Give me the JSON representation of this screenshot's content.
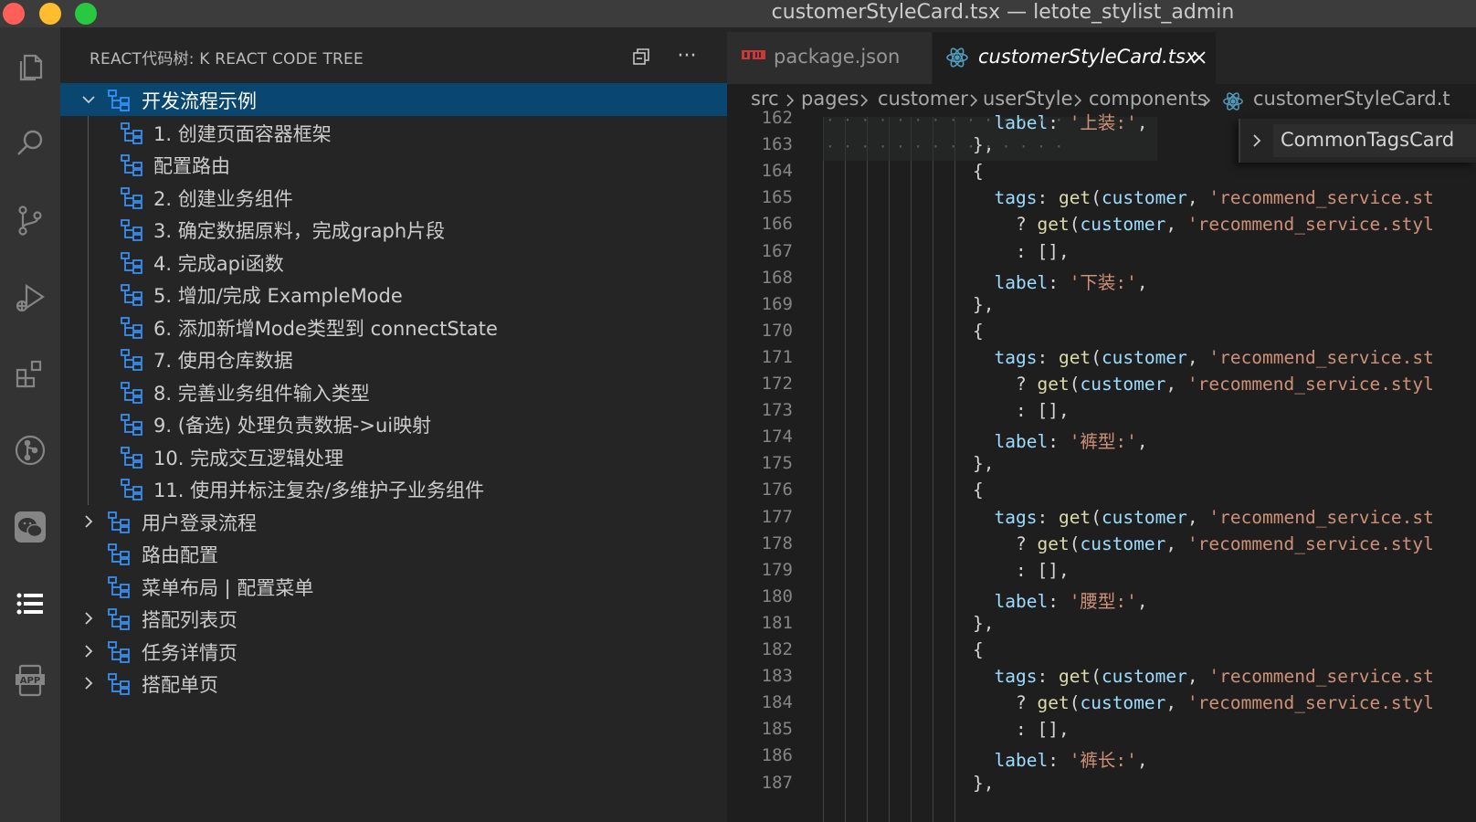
{
  "window": {
    "title": "customerStyleCard.tsx — letote_stylist_admin"
  },
  "activity_bar": {
    "items": [
      {
        "icon": "files-icon"
      },
      {
        "icon": "search-icon"
      },
      {
        "icon": "source-control-icon"
      },
      {
        "icon": "run-debug-icon"
      },
      {
        "icon": "extensions-icon"
      },
      {
        "icon": "git-graph-icon"
      },
      {
        "icon": "wechat-icon"
      },
      {
        "icon": "list-icon",
        "active": true
      },
      {
        "icon": "app-icon"
      }
    ]
  },
  "sidebar": {
    "title": "REACT代码树: K REACT CODE TREE",
    "actions": [
      {
        "icon": "collapse-all-icon"
      },
      {
        "icon": "more-actions-icon",
        "label": "···"
      }
    ],
    "tree": [
      {
        "label": "开发流程示例",
        "level": 0,
        "expanded": true,
        "selected": true
      },
      {
        "label": "1. 创建页面容器框架",
        "level": 1
      },
      {
        "label": "配置路由",
        "level": 1
      },
      {
        "label": "2. 创建业务组件",
        "level": 1
      },
      {
        "label": "3. 确定数据原料，完成graph片段",
        "level": 1
      },
      {
        "label": "4. 完成api函数",
        "level": 1
      },
      {
        "label": "5. 增加/完成 ExampleMode",
        "level": 1
      },
      {
        "label": "6. 添加新增Mode类型到 connectState",
        "level": 1
      },
      {
        "label": "7. 使用仓库数据",
        "level": 1
      },
      {
        "label": "8. 完善业务组件输入类型",
        "level": 1
      },
      {
        "label": "9. (备选) 处理负责数据->ui映射",
        "level": 1
      },
      {
        "label": "10. 完成交互逻辑处理",
        "level": 1
      },
      {
        "label": "11. 使用并标注复杂/多维护子业务组件",
        "level": 1
      },
      {
        "label": "用户登录流程",
        "level": 0,
        "expanded": false
      },
      {
        "label": "路由配置",
        "level": 0
      },
      {
        "label": "菜单布局 | 配置菜单",
        "level": 0
      },
      {
        "label": "搭配列表页",
        "level": 0,
        "expanded": false
      },
      {
        "label": "任务详情页",
        "level": 0,
        "expanded": false
      },
      {
        "label": "搭配单页",
        "level": 0,
        "expanded": false
      }
    ]
  },
  "editor": {
    "tabs": [
      {
        "label": "package.json",
        "icon": "npm-icon",
        "active": false
      },
      {
        "label": "customerStyleCard.tsx",
        "icon": "react-icon",
        "active": true
      }
    ],
    "breadcrumb": [
      "src",
      "pages",
      "customer",
      "userStyle",
      "components",
      "customerStyleCard.t"
    ],
    "peek": {
      "label": "CommonTagsCard"
    },
    "line_numbers": [
      "162",
      "163",
      "164",
      "165",
      "166",
      "167",
      "168",
      "169",
      "170",
      "171",
      "172",
      "173",
      "174",
      "175",
      "176",
      "177",
      "178",
      "179",
      "180",
      "181",
      "182",
      "183",
      "184",
      "185",
      "186",
      "187"
    ],
    "code_lines": [
      {
        "indent": 8,
        "parts": [
          [
            "prop",
            "label"
          ],
          [
            "pun",
            ": "
          ],
          [
            "str",
            "'上装:'"
          ],
          [
            "pun",
            ","
          ]
        ]
      },
      {
        "indent": 7,
        "parts": [
          [
            "pun",
            "},"
          ]
        ]
      },
      {
        "indent": 7,
        "parts": [
          [
            "pun",
            "{"
          ]
        ]
      },
      {
        "indent": 8,
        "parts": [
          [
            "prop",
            "tags"
          ],
          [
            "pun",
            ": "
          ],
          [
            "fn",
            "get"
          ],
          [
            "pun",
            "("
          ],
          [
            "prop",
            "customer"
          ],
          [
            "pun",
            ", "
          ],
          [
            "str",
            "'recommend_service.st"
          ]
        ]
      },
      {
        "indent": 9,
        "parts": [
          [
            "pun",
            "? "
          ],
          [
            "fn",
            "get"
          ],
          [
            "pun",
            "("
          ],
          [
            "prop",
            "customer"
          ],
          [
            "pun",
            ", "
          ],
          [
            "str",
            "'recommend_service.styl"
          ]
        ]
      },
      {
        "indent": 9,
        "parts": [
          [
            "pun",
            ": [],"
          ]
        ]
      },
      {
        "indent": 8,
        "parts": [
          [
            "prop",
            "label"
          ],
          [
            "pun",
            ": "
          ],
          [
            "str",
            "'下装:'"
          ],
          [
            "pun",
            ","
          ]
        ]
      },
      {
        "indent": 7,
        "parts": [
          [
            "pun",
            "},"
          ]
        ]
      },
      {
        "indent": 7,
        "parts": [
          [
            "pun",
            "{"
          ]
        ]
      },
      {
        "indent": 8,
        "parts": [
          [
            "prop",
            "tags"
          ],
          [
            "pun",
            ": "
          ],
          [
            "fn",
            "get"
          ],
          [
            "pun",
            "("
          ],
          [
            "prop",
            "customer"
          ],
          [
            "pun",
            ", "
          ],
          [
            "str",
            "'recommend_service.st"
          ]
        ]
      },
      {
        "indent": 9,
        "parts": [
          [
            "pun",
            "? "
          ],
          [
            "fn",
            "get"
          ],
          [
            "pun",
            "("
          ],
          [
            "prop",
            "customer"
          ],
          [
            "pun",
            ", "
          ],
          [
            "str",
            "'recommend_service.styl"
          ]
        ]
      },
      {
        "indent": 9,
        "parts": [
          [
            "pun",
            ": [],"
          ]
        ]
      },
      {
        "indent": 8,
        "parts": [
          [
            "prop",
            "label"
          ],
          [
            "pun",
            ": "
          ],
          [
            "str",
            "'裤型:'"
          ],
          [
            "pun",
            ","
          ]
        ]
      },
      {
        "indent": 7,
        "parts": [
          [
            "pun",
            "},"
          ]
        ]
      },
      {
        "indent": 7,
        "parts": [
          [
            "pun",
            "{"
          ]
        ]
      },
      {
        "indent": 8,
        "parts": [
          [
            "prop",
            "tags"
          ],
          [
            "pun",
            ": "
          ],
          [
            "fn",
            "get"
          ],
          [
            "pun",
            "("
          ],
          [
            "prop",
            "customer"
          ],
          [
            "pun",
            ", "
          ],
          [
            "str",
            "'recommend_service.st"
          ]
        ]
      },
      {
        "indent": 9,
        "parts": [
          [
            "pun",
            "? "
          ],
          [
            "fn",
            "get"
          ],
          [
            "pun",
            "("
          ],
          [
            "prop",
            "customer"
          ],
          [
            "pun",
            ", "
          ],
          [
            "str",
            "'recommend_service.styl"
          ]
        ]
      },
      {
        "indent": 9,
        "parts": [
          [
            "pun",
            ": [],"
          ]
        ]
      },
      {
        "indent": 8,
        "parts": [
          [
            "prop",
            "label"
          ],
          [
            "pun",
            ": "
          ],
          [
            "str",
            "'腰型:'"
          ],
          [
            "pun",
            ","
          ]
        ]
      },
      {
        "indent": 7,
        "parts": [
          [
            "pun",
            "},"
          ]
        ]
      },
      {
        "indent": 7,
        "parts": [
          [
            "pun",
            "{"
          ]
        ]
      },
      {
        "indent": 8,
        "parts": [
          [
            "prop",
            "tags"
          ],
          [
            "pun",
            ": "
          ],
          [
            "fn",
            "get"
          ],
          [
            "pun",
            "("
          ],
          [
            "prop",
            "customer"
          ],
          [
            "pun",
            ", "
          ],
          [
            "str",
            "'recommend_service.st"
          ]
        ]
      },
      {
        "indent": 9,
        "parts": [
          [
            "pun",
            "? "
          ],
          [
            "fn",
            "get"
          ],
          [
            "pun",
            "("
          ],
          [
            "prop",
            "customer"
          ],
          [
            "pun",
            ", "
          ],
          [
            "str",
            "'recommend_service.styl"
          ]
        ]
      },
      {
        "indent": 9,
        "parts": [
          [
            "pun",
            ": [],"
          ]
        ]
      },
      {
        "indent": 8,
        "parts": [
          [
            "prop",
            "label"
          ],
          [
            "pun",
            ": "
          ],
          [
            "str",
            "'裤长:'"
          ],
          [
            "pun",
            ","
          ]
        ]
      },
      {
        "indent": 7,
        "parts": [
          [
            "pun",
            "},"
          ]
        ]
      }
    ]
  },
  "colors": {
    "selection": "#094771",
    "tree_icon": "#3794ff",
    "react_icon": "#519aba",
    "npm_icon": "#cb3837"
  }
}
